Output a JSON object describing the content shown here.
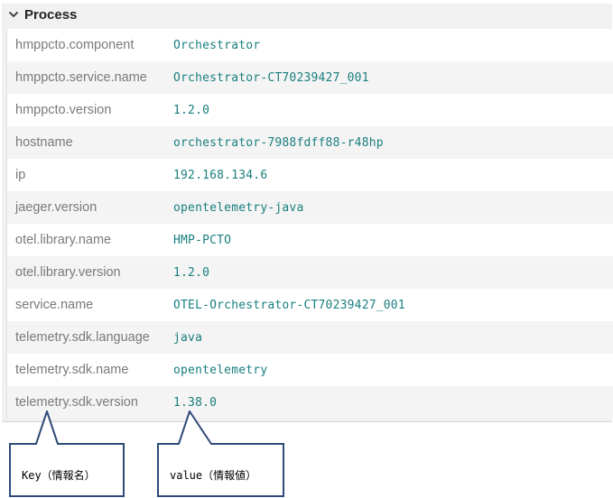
{
  "section": {
    "title": "Process",
    "toggle_icon": "chevron-down-icon"
  },
  "rows": [
    {
      "key": "hmppcto.component",
      "value": "Orchestrator"
    },
    {
      "key": "hmppcto.service.name",
      "value": "Orchestrator-CT70239427_001"
    },
    {
      "key": "hmppcto.version",
      "value": "1.2.0"
    },
    {
      "key": "hostname",
      "value": "orchestrator-7988fdff88-r48hp"
    },
    {
      "key": "ip",
      "value": "192.168.134.6"
    },
    {
      "key": "jaeger.version",
      "value": "opentelemetry-java"
    },
    {
      "key": "otel.library.name",
      "value": "HMP-PCTO"
    },
    {
      "key": "otel.library.version",
      "value": "1.2.0"
    },
    {
      "key": "service.name",
      "value": "OTEL-Orchestrator-CT70239427_001"
    },
    {
      "key": "telemetry.sdk.language",
      "value": "java"
    },
    {
      "key": "telemetry.sdk.name",
      "value": "opentelemetry"
    },
    {
      "key": "telemetry.sdk.version",
      "value": "1.38.0"
    }
  ],
  "annotations": {
    "key_label": "Key（情報名）",
    "value_label": "value（情報値）",
    "border_color": "#2e4a78"
  },
  "colors": {
    "key_text": "#7a7a7a",
    "value_text": "#1a7e7e",
    "panel_bg": "#f1f1f1"
  }
}
